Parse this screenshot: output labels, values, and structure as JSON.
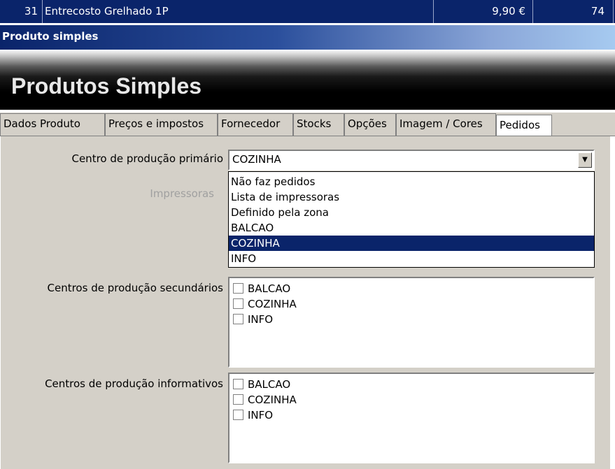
{
  "list_row": {
    "number": "31",
    "name": "Entrecosto Grelhado 1P",
    "price": "9,90 €",
    "qty": "74"
  },
  "window_title": "Produto simples",
  "banner_title": "Produtos Simples",
  "tabs": [
    {
      "label": "Dados Produto"
    },
    {
      "label": "Preços e impostos"
    },
    {
      "label": "Fornecedor"
    },
    {
      "label": "Stocks"
    },
    {
      "label": "Opções"
    },
    {
      "label": "Imagem / Cores"
    },
    {
      "label": "Pedidos"
    }
  ],
  "active_tab": "Pedidos",
  "form": {
    "primary_label": "Centro de produção primário",
    "primary_value": "COZINHA",
    "printers_label": "Impressoras",
    "secondary_label": "Centros de produção secundários",
    "informative_label": "Centros de produção informativos"
  },
  "dropdown_options": [
    "Não faz pedidos",
    "Lista de impressoras",
    "Definido pela zona",
    "BALCAO",
    "COZINHA",
    "INFO"
  ],
  "dropdown_selected": "COZINHA",
  "secondary_centers": [
    {
      "label": "BALCAO",
      "checked": false
    },
    {
      "label": "COZINHA",
      "checked": false
    },
    {
      "label": "INFO",
      "checked": false
    }
  ],
  "informative_centers": [
    {
      "label": "BALCAO",
      "checked": false
    },
    {
      "label": "COZINHA",
      "checked": false
    },
    {
      "label": "INFO",
      "checked": false
    }
  ],
  "colors": {
    "selection": "#0a246a",
    "face": "#d4d0c8"
  },
  "icons": {
    "combo_button": "chevron-down-icon"
  }
}
